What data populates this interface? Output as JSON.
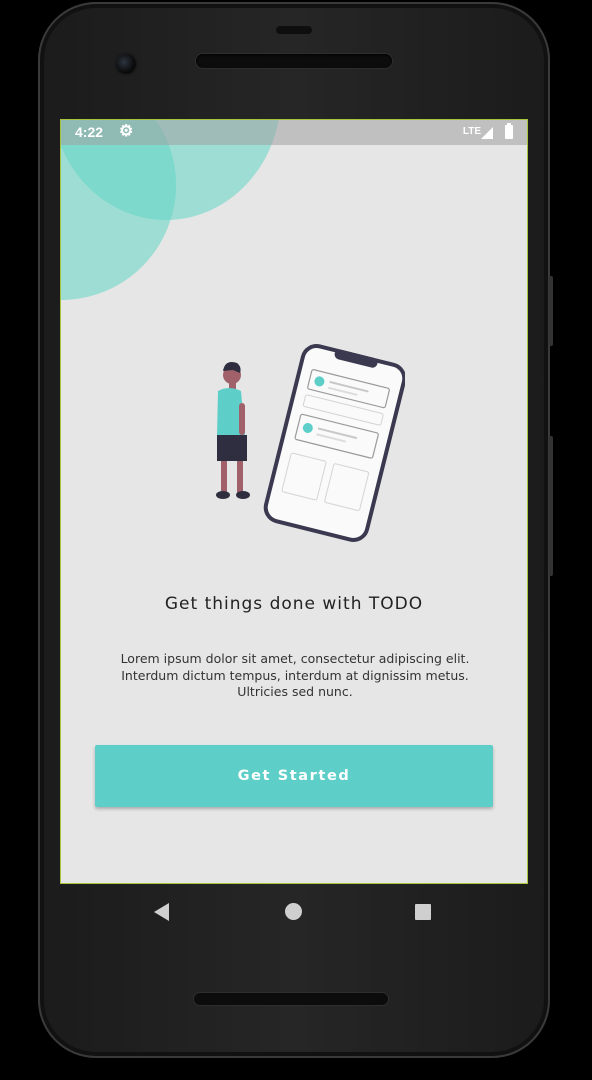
{
  "status_bar": {
    "time": "4:22",
    "settings_icon": "gear-icon",
    "network": "LTE",
    "signal_icon": "signal-icon",
    "battery_icon": "battery-icon"
  },
  "onboarding": {
    "illustration": "person-with-phone-illustration",
    "title": "Get things done with TODO",
    "description": "Lorem ipsum dolor sit amet, consectetur adipiscing elit. Interdum dictum tempus, interdum at dignissim metus. Ultricies sed nunc.",
    "cta_label": "Get Started"
  },
  "nav_bar": {
    "back_icon": "back-triangle-icon",
    "home_icon": "home-circle-icon",
    "recents_icon": "recents-square-icon"
  },
  "colors": {
    "accent": "#5ecfc8",
    "background": "#e6e6e6",
    "blob": "#60d6c4",
    "title_text": "#222222"
  }
}
